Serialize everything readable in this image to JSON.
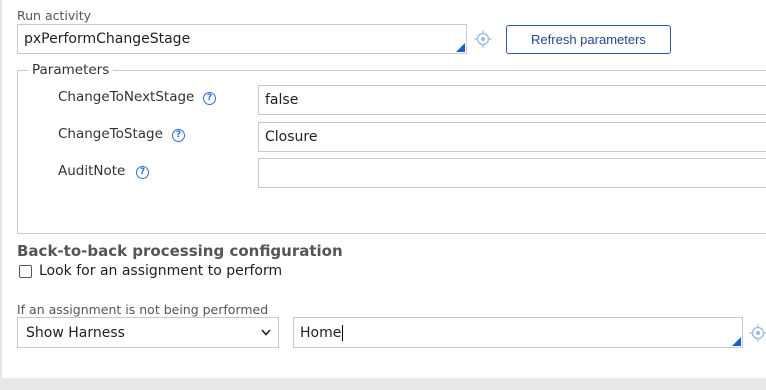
{
  "run_activity": {
    "label": "Run activity",
    "value": "pxPerformChangeStage",
    "refresh_button": "Refresh parameters"
  },
  "parameters": {
    "legend": "Parameters",
    "items": [
      {
        "name": "ChangeToNextStage",
        "value": "false"
      },
      {
        "name": "ChangeToStage",
        "value": "Closure"
      },
      {
        "name": "AuditNote",
        "value": ""
      }
    ],
    "help_glyph": "?"
  },
  "back_to_back": {
    "title": "Back-to-back processing configuration",
    "checkbox_label": "Look for an assignment to perform",
    "checked": false
  },
  "not_performed": {
    "label": "If an assignment is not being performed",
    "select_value": "Show Harness",
    "harness_value": "Home"
  },
  "icons": {
    "target": "target-icon",
    "help": "help-icon",
    "chevron": "chevron-down-icon"
  },
  "colors": {
    "accent": "#1a5fc8",
    "button_text": "#24478f",
    "help": "#2f6fd6"
  }
}
